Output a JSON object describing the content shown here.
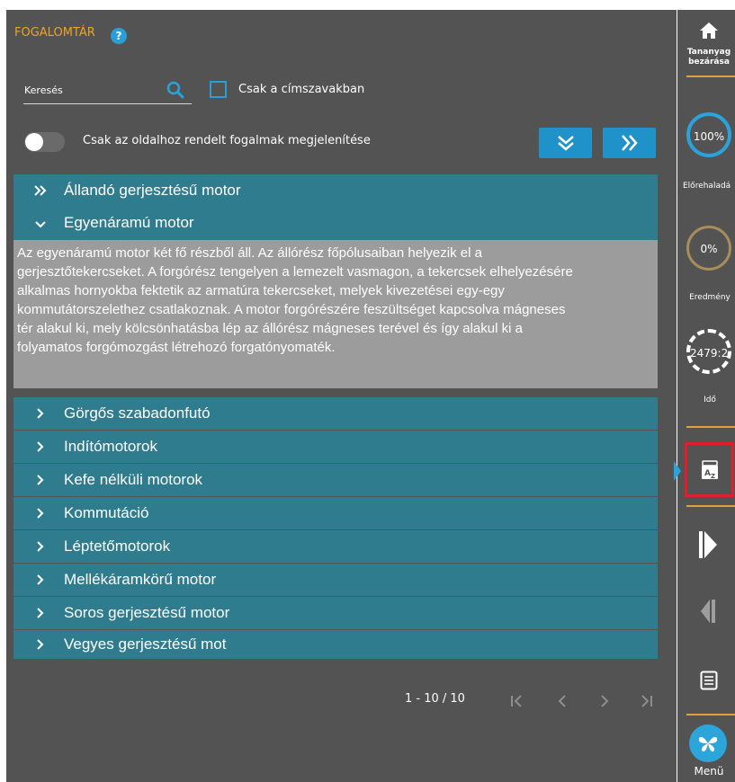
{
  "header": {
    "title": "FOGALOMTÁR",
    "help_icon": "question-icon"
  },
  "search": {
    "placeholder": "Keresés",
    "icon": "search-icon"
  },
  "filter": {
    "headwords_only_label": "Csak a címszavakban",
    "checked": false
  },
  "toggle": {
    "label": "Csak az oldalhoz rendelt fogalmak megjelenítése",
    "on": false
  },
  "buttons": {
    "collapse_all_icon": "double-chevron-down-icon",
    "expand_all_icon": "double-chevron-right-icon"
  },
  "terms": [
    {
      "label": "Állandó gerjesztésű motor",
      "state": "collapsed-double"
    },
    {
      "label": "Egyenáramú motor",
      "state": "expanded"
    },
    {
      "label": "Görgős szabadonfutó",
      "state": "collapsed"
    },
    {
      "label": "Indítómotorok",
      "state": "collapsed"
    },
    {
      "label": "Kefe nélküli motorok",
      "state": "collapsed"
    },
    {
      "label": "Kommutáció",
      "state": "collapsed"
    },
    {
      "label": "Léptetőmotorok",
      "state": "collapsed"
    },
    {
      "label": "Mellékáramkörű motor",
      "state": "collapsed"
    },
    {
      "label": "Soros gerjesztésű motor",
      "state": "collapsed"
    },
    {
      "label": "Vegyes gerjesztésű mot",
      "state": "collapsed"
    }
  ],
  "description": {
    "lines": [
      "Az egyenáramú motor két fő részből áll. Az állórész főpólusaiban helyezik el a",
      "gerjesztőtekercseket. A forgórész tengelyen a lemezelt vasmagon, a tekercsek elhelyezésére",
      "alkalmas hornyokba fektetik az armatúra tekercseket, melyek kivezetései egy-egy",
      "kommutátorszelethez csatlakoznak. A motor forgórészére feszültséget kapcsolva mágneses",
      "tér alakul ki, mely kölcsönhatásba lép az állórész mágneses terével és így alakul ki a",
      "folyamatos forgómozgást létrehozó forgatónyomaték."
    ]
  },
  "pagination": {
    "range": "1 - 10 / 10"
  },
  "sidebar": {
    "close_label_1": "Tananyag",
    "close_label_2": "bezárása",
    "progress_value": "100%",
    "progress_fraction": 1.0,
    "progress_label": "Előrehaladá",
    "result_value": "0%",
    "result_fraction": 0.0,
    "result_label": "Eredmény",
    "timer_value": "2479:2",
    "timer_label": "Idő",
    "menu_label": "Menü"
  },
  "colors": {
    "panel": "#535353",
    "accent_orange": "#f0a226",
    "accent_blue": "#1f93c9",
    "row_teal": "#2f7c8e",
    "desc_grey": "#9c9c9c",
    "highlight_red": "#e01f2d"
  }
}
